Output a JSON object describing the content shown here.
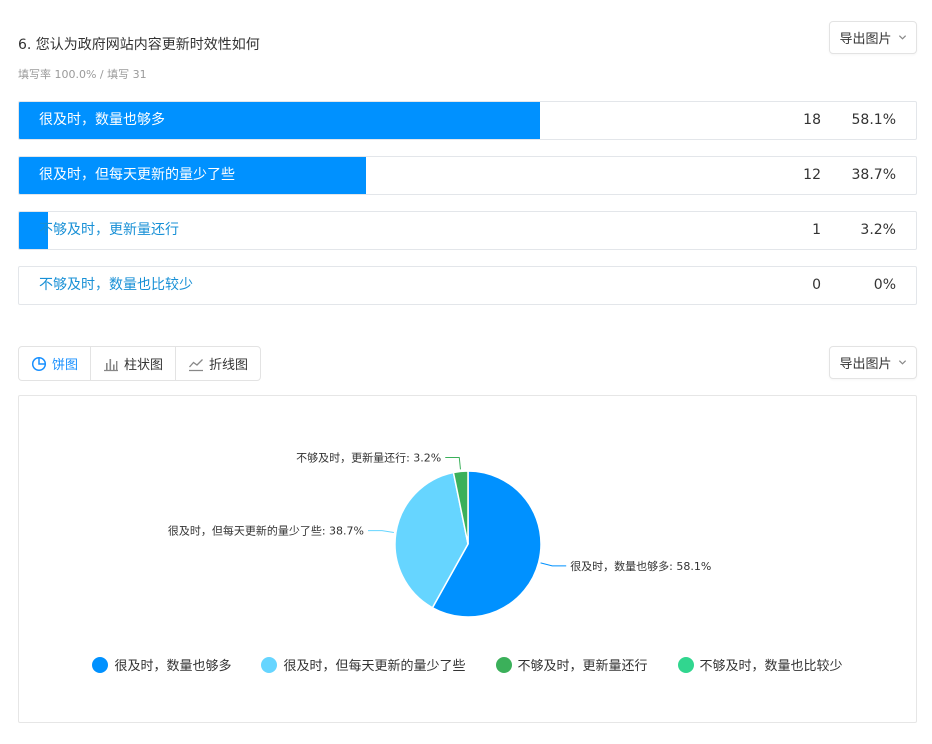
{
  "question": {
    "title": "6. 您认为政府网站内容更新时效性如何",
    "meta": "填写率 100.0% / 填写 31"
  },
  "export_label": "导出图片",
  "options": [
    {
      "label": "很及时，数量也够多",
      "count": "18",
      "percent": "58.1%",
      "fraction": 0.581
    },
    {
      "label": "很及时，但每天更新的量少了些",
      "count": "12",
      "percent": "38.7%",
      "fraction": 0.387
    },
    {
      "label": "不够及时，更新量还行",
      "count": "1",
      "percent": "3.2%",
      "fraction": 0.032
    },
    {
      "label": "不够及时，数量也比较少",
      "count": "0",
      "percent": "0%",
      "fraction": 0
    }
  ],
  "tabs": [
    {
      "label": "饼图",
      "icon": "pie-chart-icon",
      "active": true
    },
    {
      "label": "柱状图",
      "icon": "bar-chart-icon",
      "active": false
    },
    {
      "label": "折线图",
      "icon": "line-chart-icon",
      "active": false
    }
  ],
  "colors": {
    "accent": "#0091ff",
    "series": [
      "#0091ff",
      "#66d5ff",
      "#3bb05a",
      "#31d68f"
    ],
    "option_text": "#1890d6"
  },
  "chart_data": {
    "type": "pie",
    "legend_position": "bottom",
    "slices": [
      {
        "label": "很及时，数量也够多",
        "value": 58.1,
        "count": 18,
        "data_label": "很及时，数量也够多: 58.1%"
      },
      {
        "label": "很及时，但每天更新的量少了些",
        "value": 38.7,
        "count": 12,
        "data_label": "很及时，但每天更新的量少了些: 38.7%"
      },
      {
        "label": "不够及时，更新量还行",
        "value": 3.2,
        "count": 1,
        "data_label": "不够及时，更新量还行: 3.2%"
      },
      {
        "label": "不够及时，数量也比较少",
        "value": 0,
        "count": 0,
        "data_label": ""
      }
    ]
  }
}
